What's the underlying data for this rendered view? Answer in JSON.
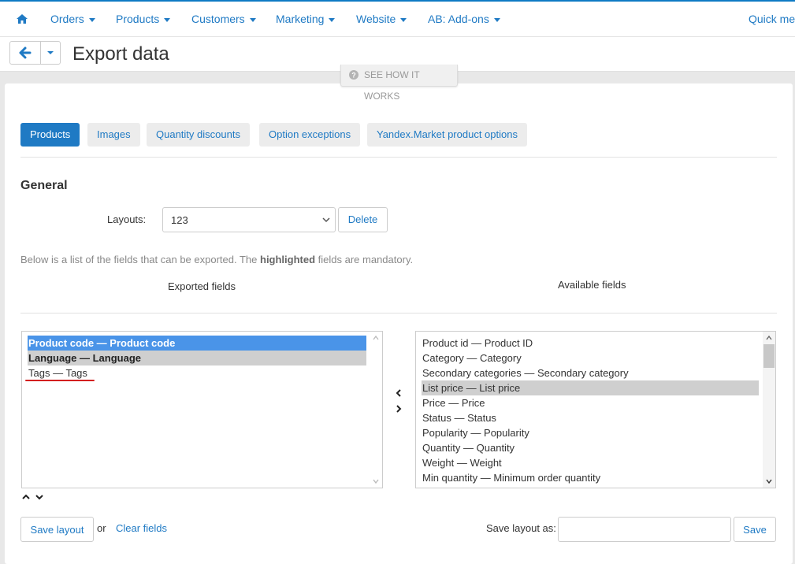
{
  "nav": {
    "items": [
      {
        "label": "Orders"
      },
      {
        "label": "Products"
      },
      {
        "label": "Customers"
      },
      {
        "label": "Marketing"
      },
      {
        "label": "Website"
      },
      {
        "label": "AB: Add-ons"
      }
    ],
    "quick_menu": "Quick menu"
  },
  "header": {
    "title": "Export data",
    "see_how": "SEE HOW IT WORKS"
  },
  "tabs": [
    {
      "label": "Products",
      "active": true
    },
    {
      "label": "Images"
    },
    {
      "label": "Quantity discounts"
    },
    {
      "label": "Option exceptions"
    },
    {
      "label": "Yandex.Market product options"
    }
  ],
  "general": {
    "heading": "General",
    "layouts_label": "Layouts:",
    "layouts_value": "123",
    "delete_label": "Delete",
    "hint_before": "Below is a list of the fields that can be exported. The ",
    "hint_bold": "highlighted",
    "hint_after": " fields are mandatory."
  },
  "exported": {
    "label": "Exported fields",
    "items": [
      {
        "label": "Product code — Product code"
      },
      {
        "label": "Language — Language"
      },
      {
        "label": "Tags — Tags"
      }
    ]
  },
  "available": {
    "label": "Available fields",
    "items": [
      {
        "label": "Product id — Product ID"
      },
      {
        "label": "Category — Category"
      },
      {
        "label": "Secondary categories — Secondary category"
      },
      {
        "label": "List price — List price"
      },
      {
        "label": "Price — Price"
      },
      {
        "label": "Status — Status"
      },
      {
        "label": "Popularity — Popularity"
      },
      {
        "label": "Quantity — Quantity"
      },
      {
        "label": "Weight — Weight"
      },
      {
        "label": "Min quantity — Minimum order quantity"
      }
    ]
  },
  "footer": {
    "save_layout": "Save layout",
    "or": "or",
    "clear_fields": "Clear fields",
    "save_as_label": "Save layout as:",
    "save_as_value": "",
    "save": "Save"
  },
  "colors": {
    "accent": "#1f7ac4",
    "selected_blue": "#4a94e8",
    "mandatory_gray": "#cfcfcf",
    "annotation_red": "#d32020"
  }
}
